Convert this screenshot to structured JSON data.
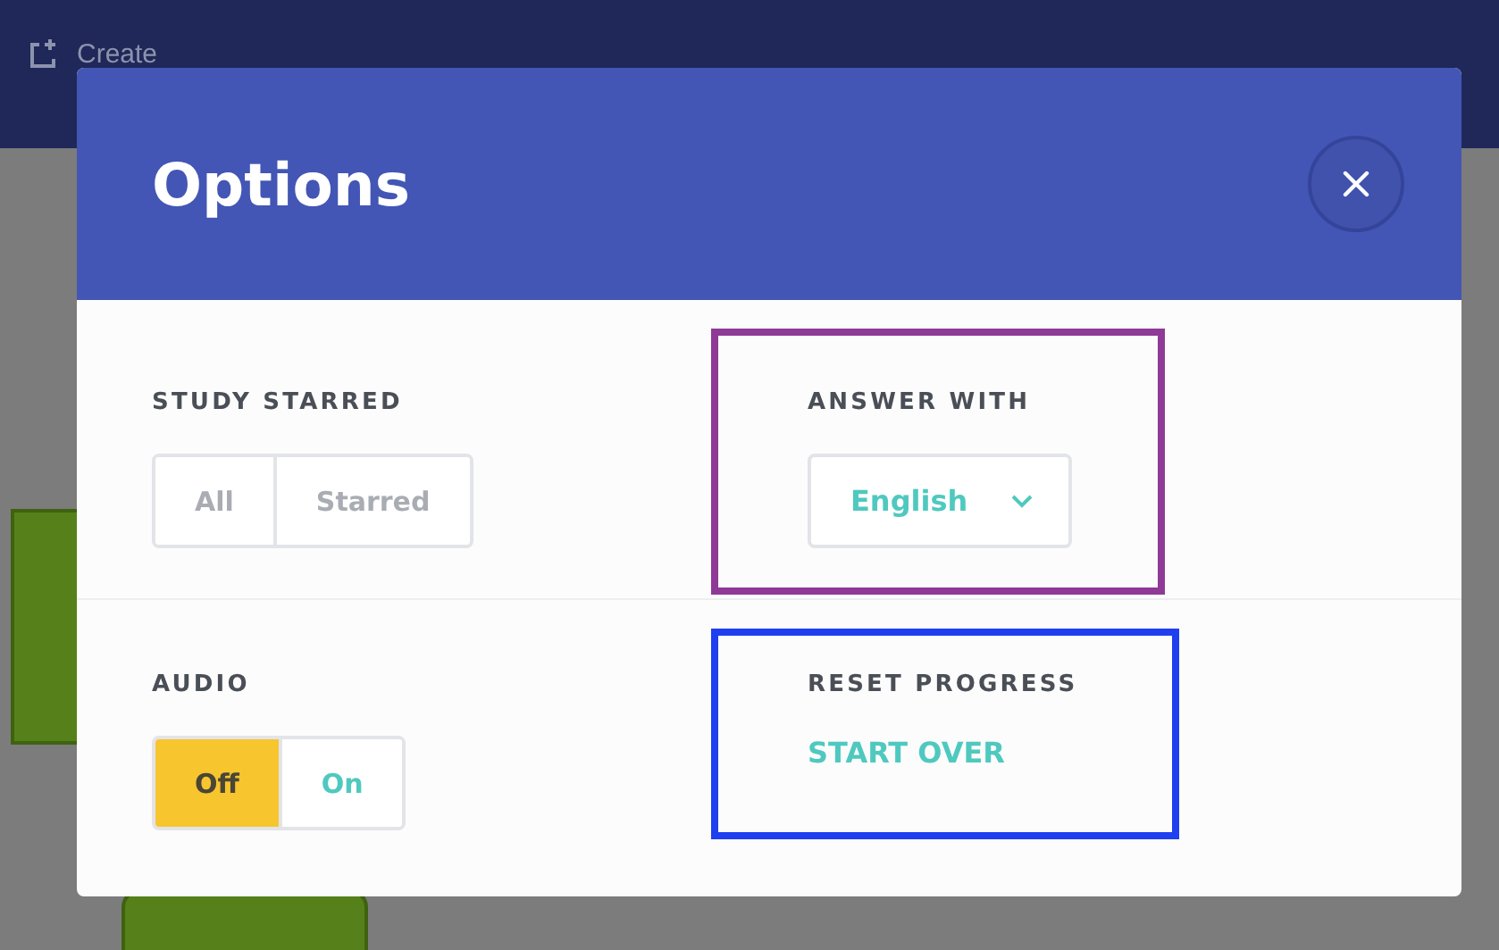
{
  "nav": {
    "create_label": "Create"
  },
  "modal": {
    "title": "Options",
    "rows": [
      [
        {
          "label": "STUDY STARRED",
          "kind": "segmented",
          "disabled": true,
          "options": [
            {
              "label": "All",
              "selected": false
            },
            {
              "label": "Starred",
              "selected": false
            }
          ]
        },
        {
          "label": "ANSWER WITH",
          "kind": "dropdown",
          "value": "English",
          "color": "#8e3a96"
        }
      ],
      [
        {
          "label": "AUDIO",
          "kind": "segmented",
          "disabled": false,
          "options": [
            {
              "label": "Off",
              "selected": true
            },
            {
              "label": "On",
              "selected": false
            }
          ]
        },
        {
          "label": "RESET PROGRESS",
          "kind": "link",
          "link": "START OVER",
          "color": "#1f3ff0"
        }
      ]
    ]
  }
}
